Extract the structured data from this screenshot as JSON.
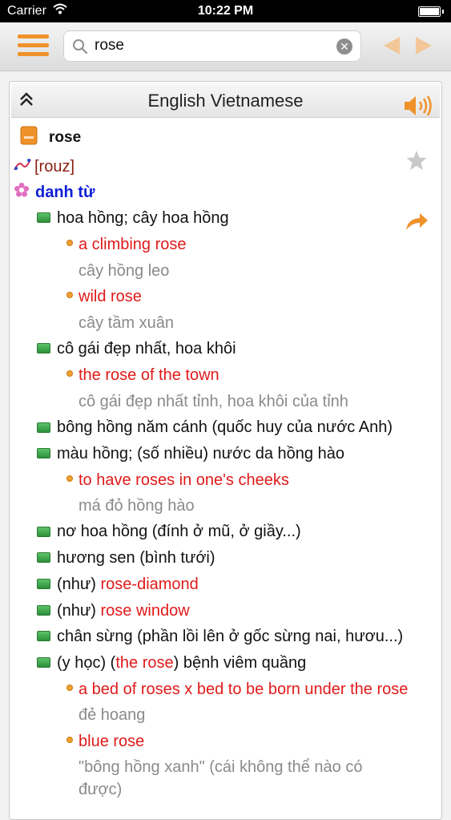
{
  "status_bar": {
    "carrier": "Carrier",
    "time": "10:22 PM"
  },
  "search": {
    "value": "rose",
    "placeholder": ""
  },
  "panel": {
    "title": "English Vietnamese"
  },
  "entry": {
    "headword": "rose",
    "pronunciation": "[rouz]",
    "part_of_speech": "danh từ",
    "senses": {
      "s1": {
        "meaning": "hoa hồng; cây hoa hồng"
      },
      "ex1": {
        "text": "a climbing rose",
        "translation": "cây hồng leo"
      },
      "ex2": {
        "text": "wild rose",
        "translation": "cây tầm xuân"
      },
      "s2": {
        "meaning": "cô gái đẹp nhất, hoa khôi"
      },
      "ex3": {
        "text": "the rose of the town",
        "translation": "cô gái đẹp nhất tỉnh, hoa khôi của tỉnh"
      },
      "s3": {
        "meaning": "bông hồng năm cánh (quốc huy của nước Anh)"
      },
      "s4": {
        "meaning": "màu hồng; (số nhiều) nước da hồng hào"
      },
      "ex4": {
        "text": "to have roses in one's cheeks",
        "translation": "má đỏ hồng hào"
      },
      "s5": {
        "meaning": "nơ hoa hồng (đính ở mũ, ở giầy...)"
      },
      "s6": {
        "meaning": "hương sen (bình tưới)"
      },
      "s7": {
        "prefix": "(như) ",
        "link": "rose-diamond"
      },
      "s8": {
        "prefix": "(như) ",
        "link": "rose window"
      },
      "s9": {
        "meaning": "chân sừng (phần lồi lên ở gốc sừng nai, hươu...)"
      },
      "s10": {
        "prefix": "(y học) (",
        "link": "the rose",
        "suffix": ") bệnh viêm quầng"
      },
      "ex5": {
        "text": "a bed of roses x bed to be born under the rose",
        "translation": "đẻ hoang"
      },
      "ex6": {
        "text": "blue rose",
        "translation_line1": "\"bông hồng xanh\" (cái không thể nào có",
        "translation_line2": "được)"
      }
    }
  },
  "colors": {
    "accent": "#f0922a",
    "example_red": "#e01a1a",
    "pos_blue": "#1020d6",
    "pronunciation": "#8b1f12",
    "translation_gray": "#8a8a8a"
  },
  "icons": [
    "wifi-icon",
    "battery-icon",
    "menu-icon",
    "search-icon",
    "clear-icon",
    "back-arrow-icon",
    "forward-arrow-icon",
    "collapse-icon",
    "speaker-icon",
    "dictionary-book-icon",
    "pronunciation-icon",
    "flower-icon",
    "star-icon",
    "share-icon"
  ]
}
